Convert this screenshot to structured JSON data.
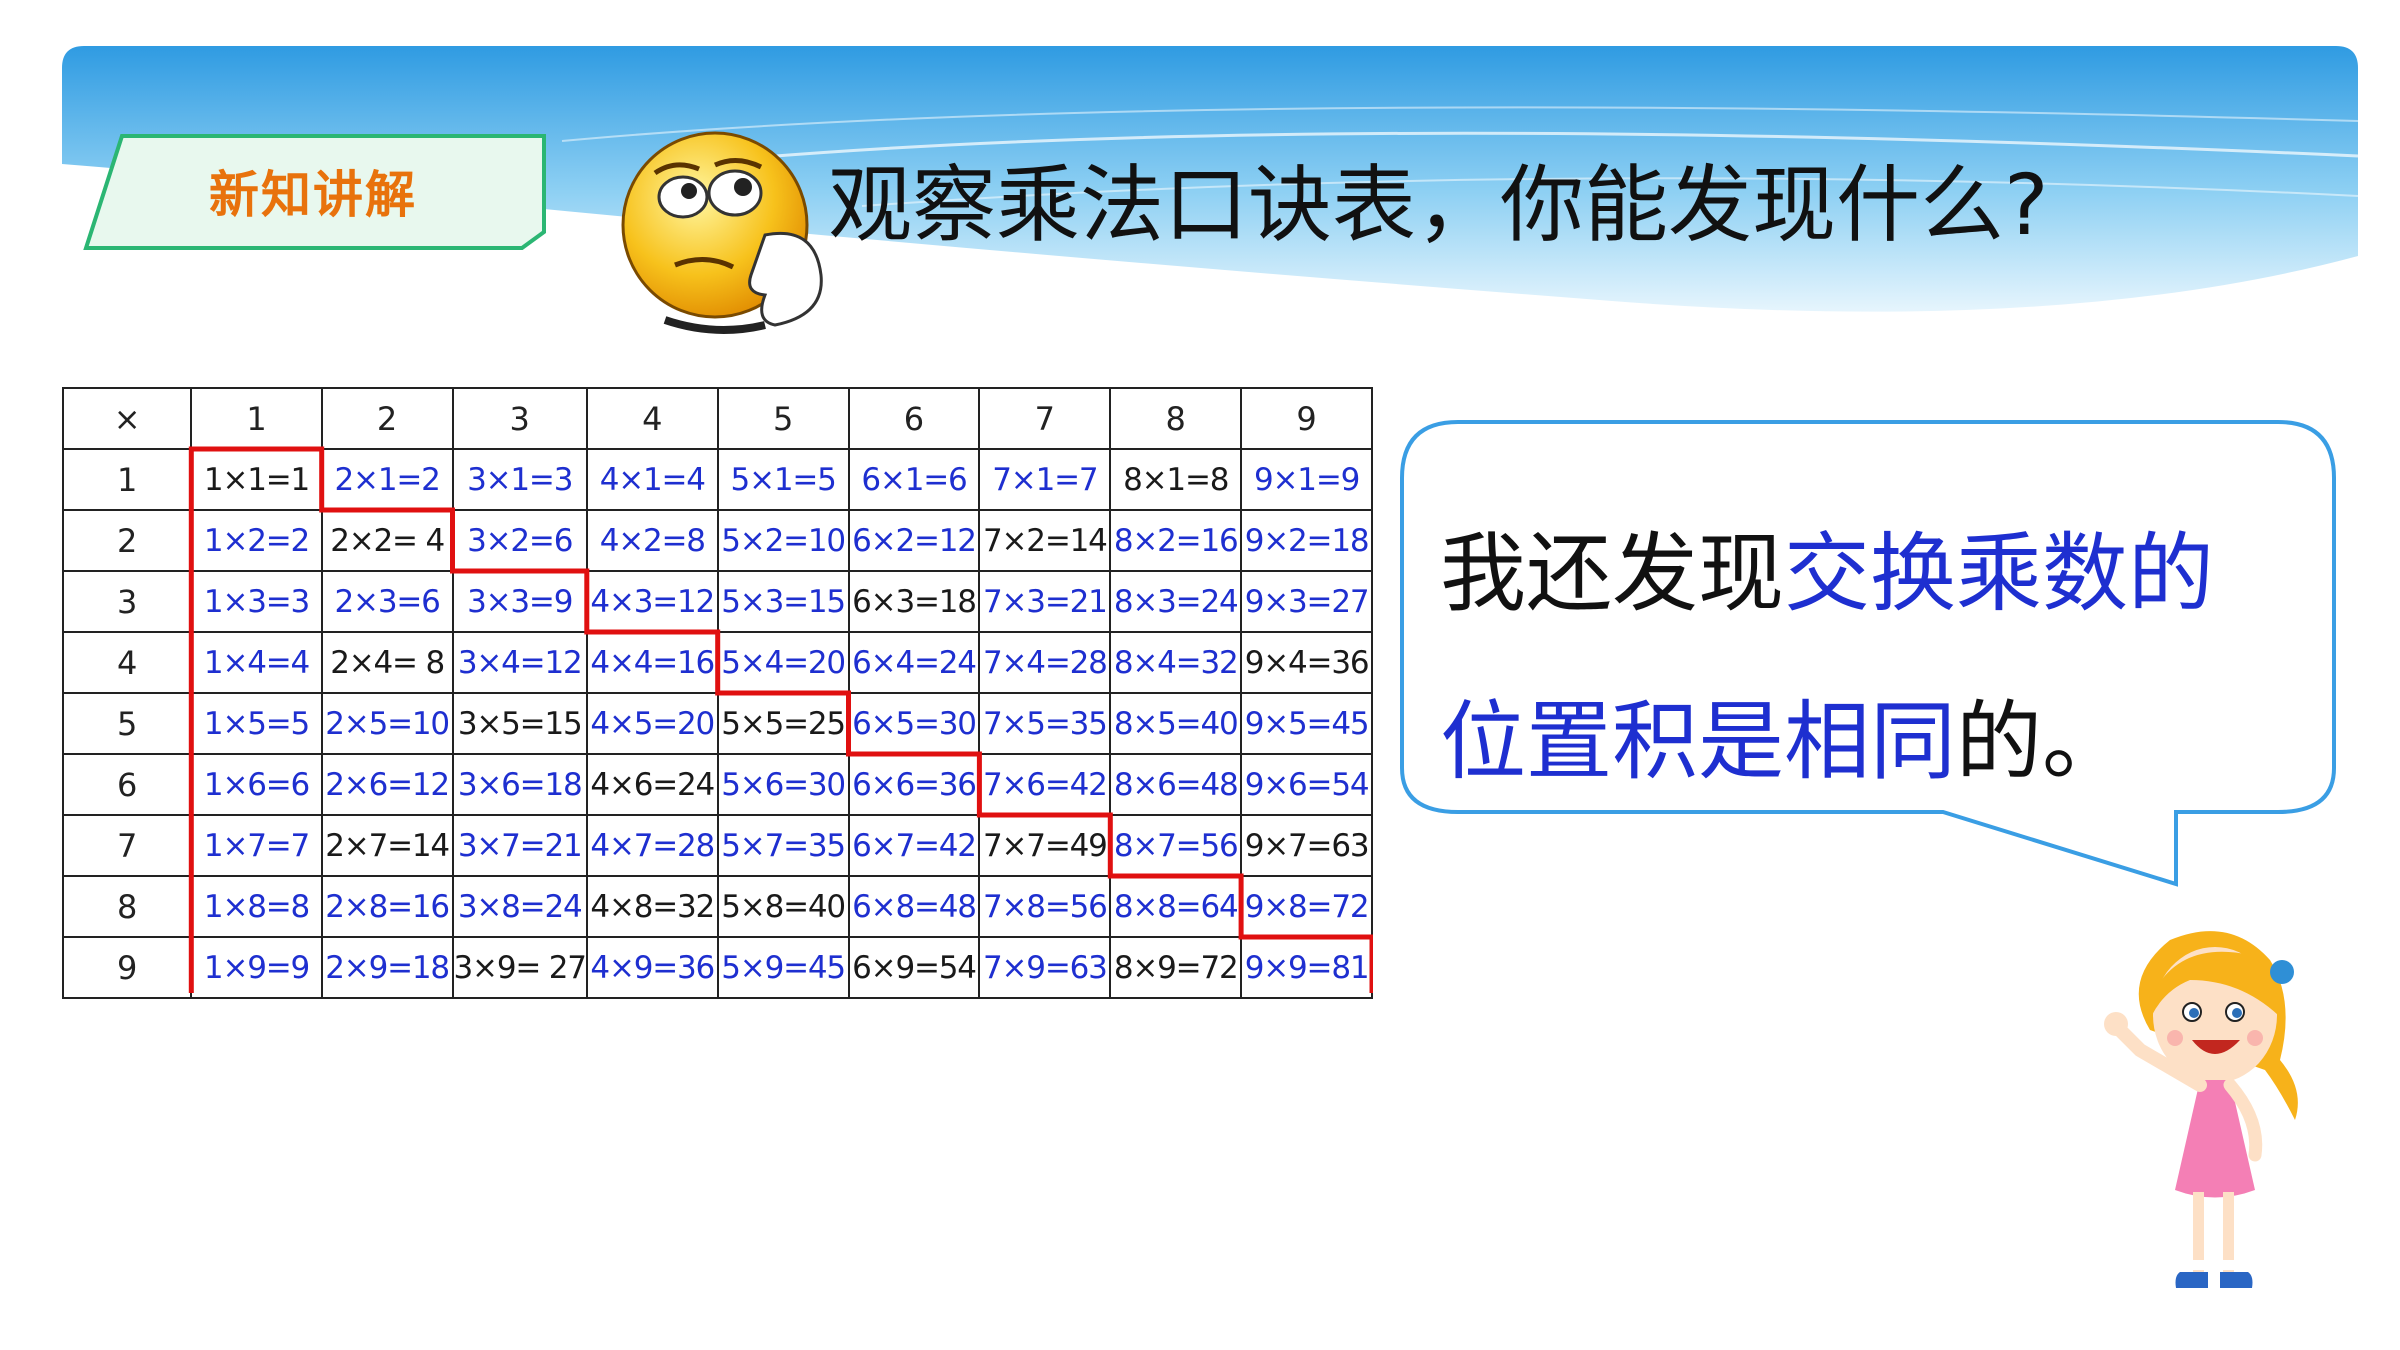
{
  "section_tag": "新知讲解",
  "title": "观察乘法口诀表，你能发现什么?",
  "bubble": {
    "part1": "我还发现",
    "part2": "交换乘数的",
    "part3": "位置积是相同",
    "part4": "的。"
  },
  "colors": {
    "blue_text": "#1e2fd0",
    "highlight_line": "#e01010",
    "tag_text": "#e8720c",
    "banner": "#3aa4e6"
  },
  "table": {
    "corner": "×",
    "columns": [
      "1",
      "2",
      "3",
      "4",
      "5",
      "6",
      "7",
      "8",
      "9"
    ],
    "rows": [
      {
        "head": "1",
        "cells": [
          {
            "t": "1×1=1",
            "c": "black"
          },
          {
            "t": "2×1=2",
            "c": "blue"
          },
          {
            "t": "3×1=3",
            "c": "blue"
          },
          {
            "t": "4×1=4",
            "c": "blue"
          },
          {
            "t": "5×1=5",
            "c": "blue"
          },
          {
            "t": "6×1=6",
            "c": "blue"
          },
          {
            "t": "7×1=7",
            "c": "blue"
          },
          {
            "t": "8×1=8",
            "c": "black"
          },
          {
            "t": "9×1=9",
            "c": "blue"
          }
        ]
      },
      {
        "head": "2",
        "cells": [
          {
            "t": "1×2=2",
            "c": "blue"
          },
          {
            "t": "2×2= 4",
            "c": "black"
          },
          {
            "t": "3×2=6",
            "c": "blue"
          },
          {
            "t": "4×2=8",
            "c": "blue"
          },
          {
            "t": "5×2=10",
            "c": "blue"
          },
          {
            "t": "6×2=12",
            "c": "blue"
          },
          {
            "t": "7×2=14",
            "c": "black"
          },
          {
            "t": "8×2=16",
            "c": "blue"
          },
          {
            "t": "9×2=18",
            "c": "blue"
          }
        ]
      },
      {
        "head": "3",
        "cells": [
          {
            "t": "1×3=3",
            "c": "blue"
          },
          {
            "t": "2×3=6",
            "c": "blue"
          },
          {
            "t": "3×3=9",
            "c": "blue"
          },
          {
            "t": "4×3=12",
            "c": "blue"
          },
          {
            "t": "5×3=15",
            "c": "blue"
          },
          {
            "t": "6×3=18",
            "c": "black"
          },
          {
            "t": "7×3=21",
            "c": "blue"
          },
          {
            "t": "8×3=24",
            "c": "blue"
          },
          {
            "t": "9×3=27",
            "c": "blue"
          }
        ]
      },
      {
        "head": "4",
        "cells": [
          {
            "t": "1×4=4",
            "c": "blue"
          },
          {
            "t": "2×4= 8",
            "c": "black"
          },
          {
            "t": "3×4=12",
            "c": "blue"
          },
          {
            "t": "4×4=16",
            "c": "blue"
          },
          {
            "t": "5×4=20",
            "c": "blue"
          },
          {
            "t": "6×4=24",
            "c": "blue"
          },
          {
            "t": "7×4=28",
            "c": "blue"
          },
          {
            "t": "8×4=32",
            "c": "blue"
          },
          {
            "t": "9×4=36",
            "c": "black"
          }
        ]
      },
      {
        "head": "5",
        "cells": [
          {
            "t": "1×5=5",
            "c": "blue"
          },
          {
            "t": "2×5=10",
            "c": "blue"
          },
          {
            "t": "3×5=15",
            "c": "black"
          },
          {
            "t": "4×5=20",
            "c": "blue"
          },
          {
            "t": "5×5=25",
            "c": "black"
          },
          {
            "t": "6×5=30",
            "c": "blue"
          },
          {
            "t": "7×5=35",
            "c": "blue"
          },
          {
            "t": "8×5=40",
            "c": "blue"
          },
          {
            "t": "9×5=45",
            "c": "blue"
          }
        ]
      },
      {
        "head": "6",
        "cells": [
          {
            "t": "1×6=6",
            "c": "blue"
          },
          {
            "t": "2×6=12",
            "c": "blue"
          },
          {
            "t": "3×6=18",
            "c": "blue"
          },
          {
            "t": "4×6=24",
            "c": "black"
          },
          {
            "t": "5×6=30",
            "c": "blue"
          },
          {
            "t": "6×6=36",
            "c": "blue"
          },
          {
            "t": "7×6=42",
            "c": "blue"
          },
          {
            "t": "8×6=48",
            "c": "blue"
          },
          {
            "t": "9×6=54",
            "c": "blue"
          }
        ]
      },
      {
        "head": "7",
        "cells": [
          {
            "t": "1×7=7",
            "c": "blue"
          },
          {
            "t": "2×7=14",
            "c": "black"
          },
          {
            "t": "3×7=21",
            "c": "blue"
          },
          {
            "t": "4×7=28",
            "c": "blue"
          },
          {
            "t": "5×7=35",
            "c": "blue"
          },
          {
            "t": "6×7=42",
            "c": "blue"
          },
          {
            "t": "7×7=49",
            "c": "black"
          },
          {
            "t": "8×7=56",
            "c": "blue"
          },
          {
            "t": "9×7=63",
            "c": "black"
          }
        ]
      },
      {
        "head": "8",
        "cells": [
          {
            "t": "1×8=8",
            "c": "blue"
          },
          {
            "t": "2×8=16",
            "c": "blue"
          },
          {
            "t": "3×8=24",
            "c": "blue"
          },
          {
            "t": "4×8=32",
            "c": "black"
          },
          {
            "t": "5×8=40",
            "c": "black"
          },
          {
            "t": "6×8=48",
            "c": "blue"
          },
          {
            "t": "7×8=56",
            "c": "blue"
          },
          {
            "t": "8×8=64",
            "c": "blue"
          },
          {
            "t": "9×8=72",
            "c": "blue"
          }
        ]
      },
      {
        "head": "9",
        "cells": [
          {
            "t": "1×9=9",
            "c": "blue"
          },
          {
            "t": "2×9=18",
            "c": "blue"
          },
          {
            "t": "3×9= 27",
            "c": "black"
          },
          {
            "t": "4×9=36",
            "c": "blue"
          },
          {
            "t": "5×9=45",
            "c": "blue"
          },
          {
            "t": "6×9=54",
            "c": "black"
          },
          {
            "t": "7×9=63",
            "c": "blue"
          },
          {
            "t": "8×9=72",
            "c": "black"
          },
          {
            "t": "9×9=81",
            "c": "blue"
          }
        ]
      }
    ]
  }
}
